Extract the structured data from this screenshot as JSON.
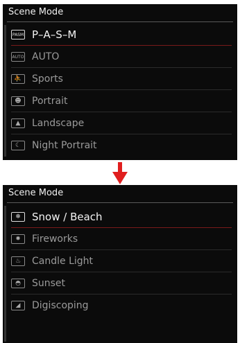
{
  "top_screen": {
    "title": "Scene Mode",
    "items": [
      {
        "label": "P–A–S–M",
        "icon": "pasm-icon",
        "icon_text": "PASM",
        "selected": true
      },
      {
        "label": "AUTO",
        "icon": "auto-icon",
        "icon_text": "AUTO",
        "selected": false
      },
      {
        "label": "Sports",
        "icon": "sports-icon",
        "icon_text": "⛹",
        "selected": false
      },
      {
        "label": "Portrait",
        "icon": "portrait-icon",
        "icon_text": "☻",
        "selected": false
      },
      {
        "label": "Landscape",
        "icon": "landscape-icon",
        "icon_text": "▲",
        "selected": false
      },
      {
        "label": "Night Portrait",
        "icon": "night-portrait-icon",
        "icon_text": "☾",
        "selected": false
      }
    ]
  },
  "bottom_screen": {
    "title": "Scene Mode",
    "items": [
      {
        "label": "Snow / Beach",
        "icon": "snow-beach-icon",
        "icon_text": "❄",
        "selected": true
      },
      {
        "label": "Fireworks",
        "icon": "fireworks-icon",
        "icon_text": "✸",
        "selected": false
      },
      {
        "label": "Candle Light",
        "icon": "candle-light-icon",
        "icon_text": "♨",
        "selected": false
      },
      {
        "label": "Sunset",
        "icon": "sunset-icon",
        "icon_text": "◓",
        "selected": false
      },
      {
        "label": "Digiscoping",
        "icon": "digiscoping-icon",
        "icon_text": "◢",
        "selected": false
      }
    ]
  },
  "colors": {
    "accent": "#e01e1e",
    "background": "#0b0b0b",
    "selected_text": "#f4f4f4",
    "dim_text": "#9a9a9a"
  }
}
